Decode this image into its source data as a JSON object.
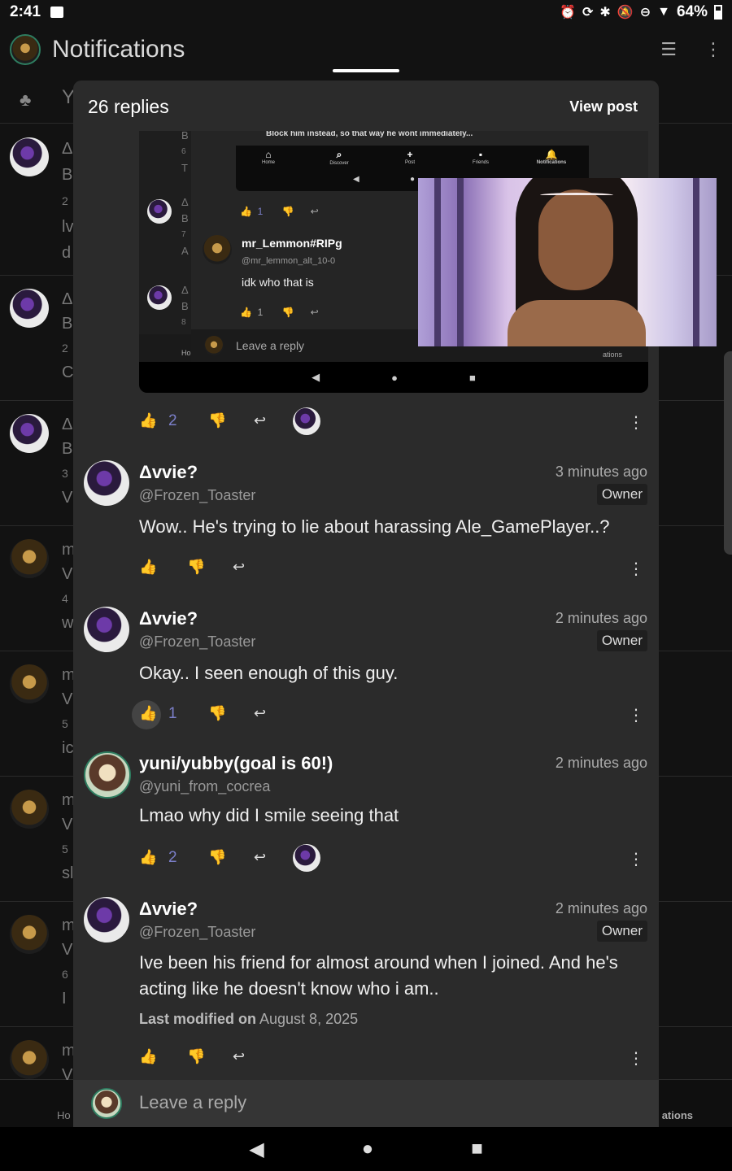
{
  "status": {
    "time": "2:41",
    "battery": "64%",
    "icons": [
      "image-icon",
      "alarm-icon",
      "sync-icon",
      "bluetooth-icon",
      "mute-icon",
      "dnd-icon",
      "wifi-icon",
      "battery-icon"
    ]
  },
  "app": {
    "title": "Notifications",
    "filter_icon": "filter-icon",
    "more_icon": "more-vert-icon"
  },
  "background": {
    "filter_letter": "Y",
    "rows": [
      {
        "l1": "Δ",
        "l2": "B",
        "l3": "2",
        "l4": "lv",
        "l5": "d"
      },
      {
        "l1": "Δ",
        "l2": "B",
        "l3": "2",
        "l4": "C"
      },
      {
        "l1": "Δ",
        "l2": "B",
        "l3": "3",
        "l4": "V"
      },
      {
        "l1": "m",
        "l2": "V",
        "l3": "4",
        "l4": "w"
      },
      {
        "l1": "m",
        "l2": "V",
        "l3": "5",
        "l4": "ic"
      },
      {
        "l1": "m",
        "l2": "V",
        "l3": "5",
        "l4": "sl"
      },
      {
        "l1": "m",
        "l2": "V",
        "l3": "6",
        "l4": "I"
      },
      {
        "l1": "m",
        "l2": "V"
      }
    ],
    "nav_left": "Ho",
    "nav_right": "ations"
  },
  "sheet": {
    "reply_count": "26 replies",
    "view_post": "View post",
    "screenshot": {
      "top_text": "Block him instead, so that way he wont immediately...",
      "tabs": [
        "Home",
        "Discover",
        "Post",
        "Friends",
        "Notifications"
      ],
      "left_letters": [
        [
          "B",
          "6",
          "T"
        ],
        [
          "Δ",
          "B",
          "7",
          "A"
        ],
        [
          "Δ",
          "B",
          "8"
        ]
      ],
      "react1_count": "1",
      "user": "mr_Lemmon#RIPg",
      "handle": "@mr_lemmon_alt_10-0",
      "text": "idk who that is",
      "react2_count": "1",
      "leave": "Leave a reply",
      "nav_left": "Ho",
      "nav_right": "ations"
    },
    "top_actions": {
      "like_count": "2"
    },
    "comments": [
      {
        "name": "Δvvie?",
        "handle": "@Frozen_Toaster",
        "time": "3 minutes ago",
        "badge": "Owner",
        "text": "Wow.. He's trying to lie about harassing Ale_GamePlayer..?",
        "like_count": ""
      },
      {
        "name": "Δvvie?",
        "handle": "@Frozen_Toaster",
        "time": "2 minutes ago",
        "badge": "Owner",
        "text": "Okay.. I seen enough of this guy.",
        "like_count": "1"
      },
      {
        "name": "yuni/yubby(goal is 60!)",
        "handle": "@yuni_from_cocrea",
        "time": "2 minutes ago",
        "badge": "",
        "text": "Lmao why did I smile seeing that",
        "like_count": "2"
      },
      {
        "name": "Δvvie?",
        "handle": "@Frozen_Toaster",
        "time": "2 minutes ago",
        "badge": "Owner",
        "text": "Ive been his friend for almost around when I joined. And he's acting like he doesn't know who i am..",
        "modified_label": "Last modified on",
        "modified_date": "August 8, 2025",
        "like_count": ""
      }
    ],
    "leave_reply": "Leave a reply"
  }
}
